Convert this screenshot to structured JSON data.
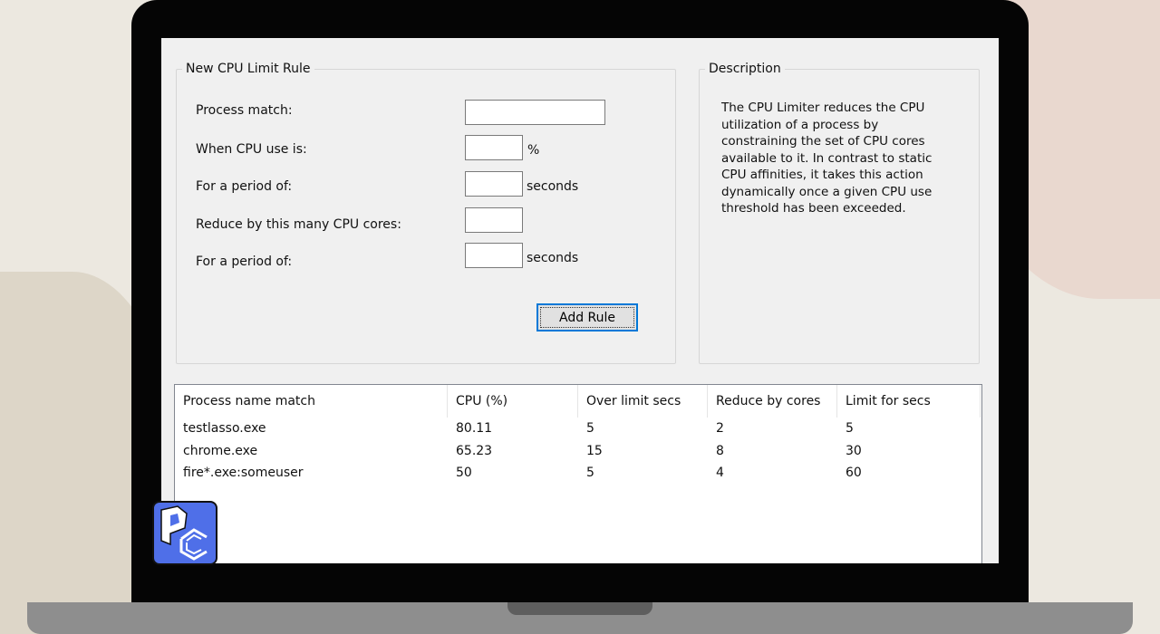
{
  "form": {
    "title": "New CPU Limit Rule",
    "fields": [
      {
        "label": "Process match:",
        "value": "",
        "unit": ""
      },
      {
        "label": "When CPU use is:",
        "value": "",
        "unit": "%"
      },
      {
        "label": "For a period of:",
        "value": "",
        "unit": "seconds"
      },
      {
        "label": "Reduce by this many CPU cores:",
        "value": "",
        "unit": ""
      },
      {
        "label": "For a period of:",
        "value": "",
        "unit": "seconds"
      }
    ],
    "add_button": "Add Rule"
  },
  "description": {
    "title": "Description",
    "text": "The CPU Limiter reduces the CPU utilization of a process by constraining the set of CPU cores available to it. In contrast to static CPU affinities, it takes this action dynamically once a given CPU use threshold has been exceeded."
  },
  "table": {
    "headers": [
      "Process name match",
      "CPU (%)",
      "Over limit secs",
      "Reduce by cores",
      "Limit for secs"
    ],
    "rows": [
      [
        "testlasso.exe",
        "80.11",
        "5",
        "2",
        "5"
      ],
      [
        "chrome.exe",
        "65.23",
        "15",
        "8",
        "30"
      ],
      [
        "fire*.exe:someuser",
        "50",
        "5",
        "4",
        "60"
      ]
    ]
  },
  "colors": {
    "accent": "#0078d7",
    "logo": "#4f6fe8"
  }
}
